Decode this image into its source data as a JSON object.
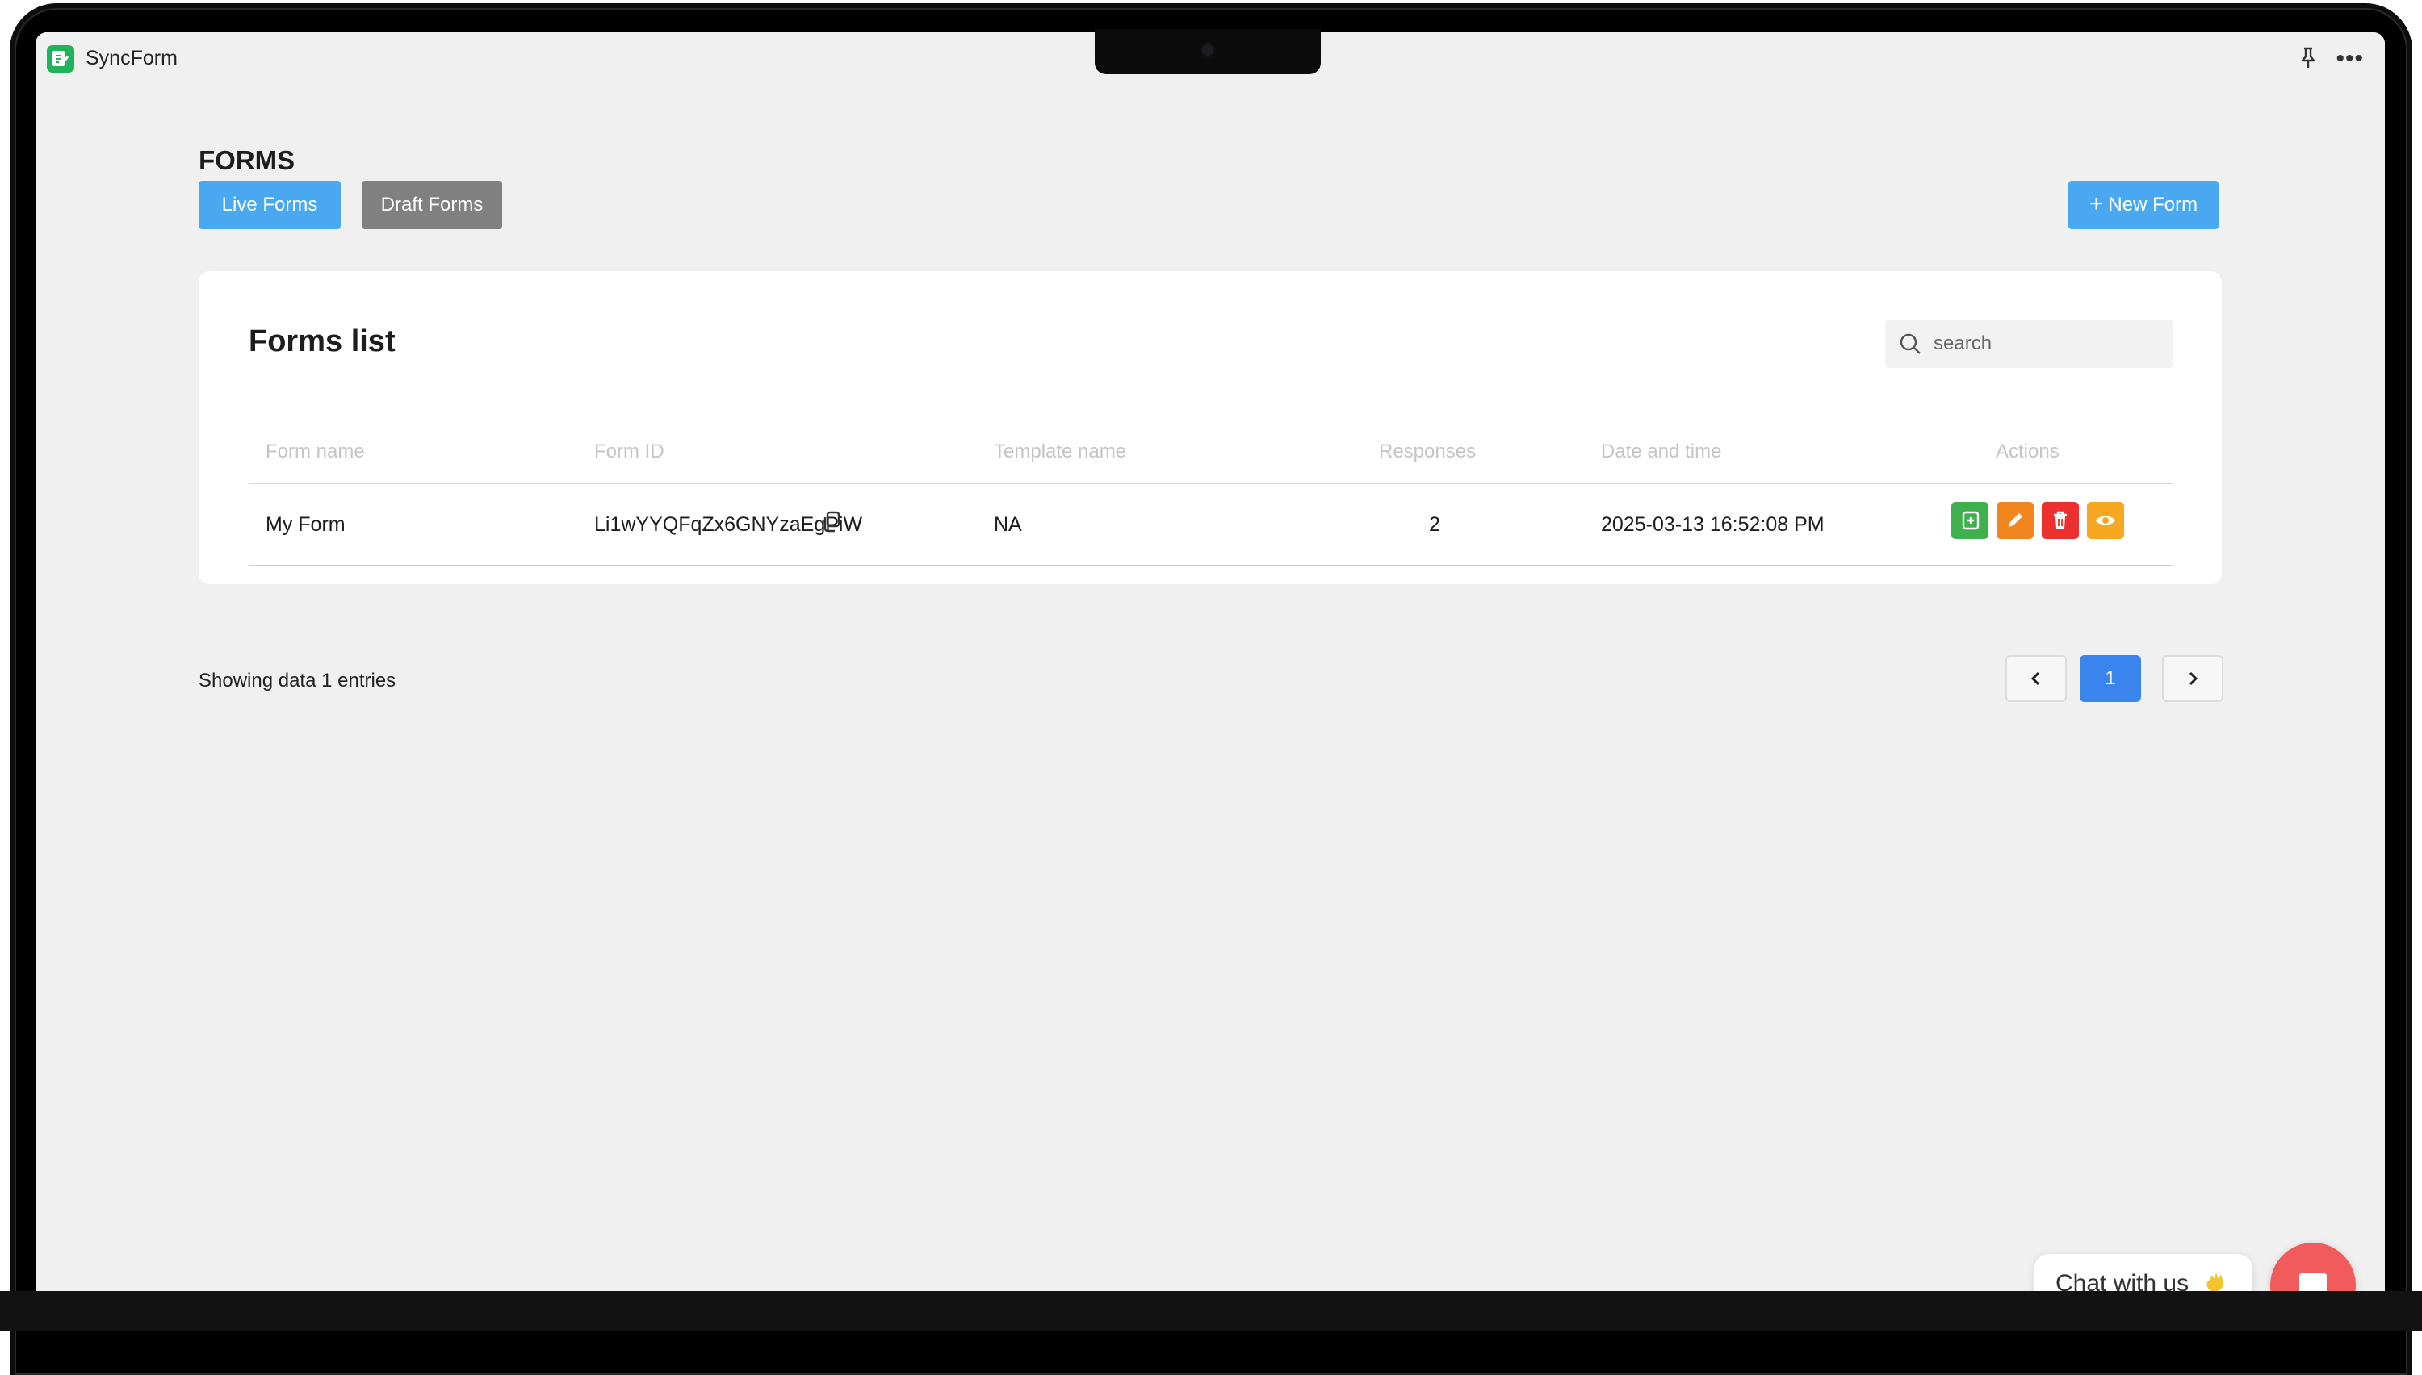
{
  "app": {
    "name": "SyncForm"
  },
  "page": {
    "title": "FORMS"
  },
  "tabs": {
    "live_label": "Live Forms",
    "draft_label": "Draft Forms"
  },
  "new_form": {
    "icon": "plus-icon",
    "label": "New Form"
  },
  "forms_card": {
    "title": "Forms list",
    "search_placeholder": "search",
    "columns": [
      "Form name",
      "Form ID",
      "Template name",
      "Responses",
      "Date and time",
      "Actions"
    ],
    "rows": [
      {
        "form_name": "My Form",
        "form_id": "Li1wYYQFqZx6GNYzaEgPiW",
        "template_name": "NA",
        "responses": "2",
        "date_time": "2025-03-13 16:52:08 PM",
        "actions": [
          "duplicate-icon",
          "edit-icon",
          "delete-icon",
          "view-icon"
        ]
      }
    ]
  },
  "footer": {
    "showing_text": "Showing data 1 entries",
    "current_page": "1"
  },
  "chat": {
    "label": "Chat with us"
  },
  "colors": {
    "primary_button": "#4aa8f0",
    "draft_button": "#808080",
    "active_page": "#3a84ee",
    "action_duplicate": "#3fb04e",
    "action_edit": "#f1851f",
    "action_delete": "#ec2f2f",
    "action_view": "#f6a823",
    "chat_fab": "#f25b5b"
  }
}
